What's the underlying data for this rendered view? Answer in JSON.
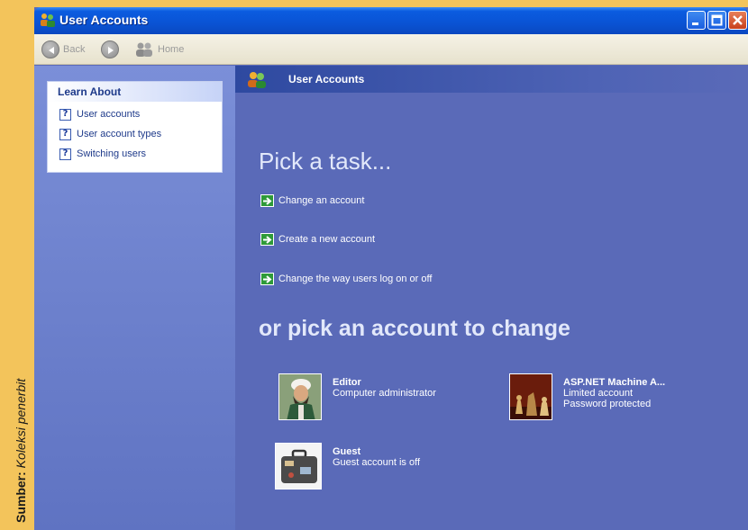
{
  "caption": {
    "bold": "Sumber:",
    "italic": "Koleksi penerbit"
  },
  "window": {
    "title": "User Accounts"
  },
  "toolbar": {
    "back_label": "Back",
    "home_label": "Home"
  },
  "left_pane": {
    "header": "Learn About",
    "items": [
      {
        "label": "User accounts"
      },
      {
        "label": "User account types"
      },
      {
        "label": "Switching users"
      }
    ]
  },
  "main": {
    "header_title": "User Accounts",
    "pick_task_title": "Pick a task...",
    "tasks": [
      {
        "label": "Change an account"
      },
      {
        "label": "Create a new account"
      },
      {
        "label": "Change the way users log on or off"
      }
    ],
    "or_pick_title": "or pick an account to change",
    "accounts": [
      {
        "name": "Editor",
        "lines": [
          "Computer administrator"
        ]
      },
      {
        "name": "ASP.NET Machine A...",
        "lines": [
          "Limited account",
          "Password protected"
        ]
      },
      {
        "name": "Guest",
        "lines": [
          "Guest account is off"
        ]
      }
    ]
  },
  "colors": {
    "caption_bg": "#f3c45b",
    "titlebar": "#0a53d4",
    "main_bg": "#5a6ab8",
    "task_arrow": "#2e9a38"
  }
}
